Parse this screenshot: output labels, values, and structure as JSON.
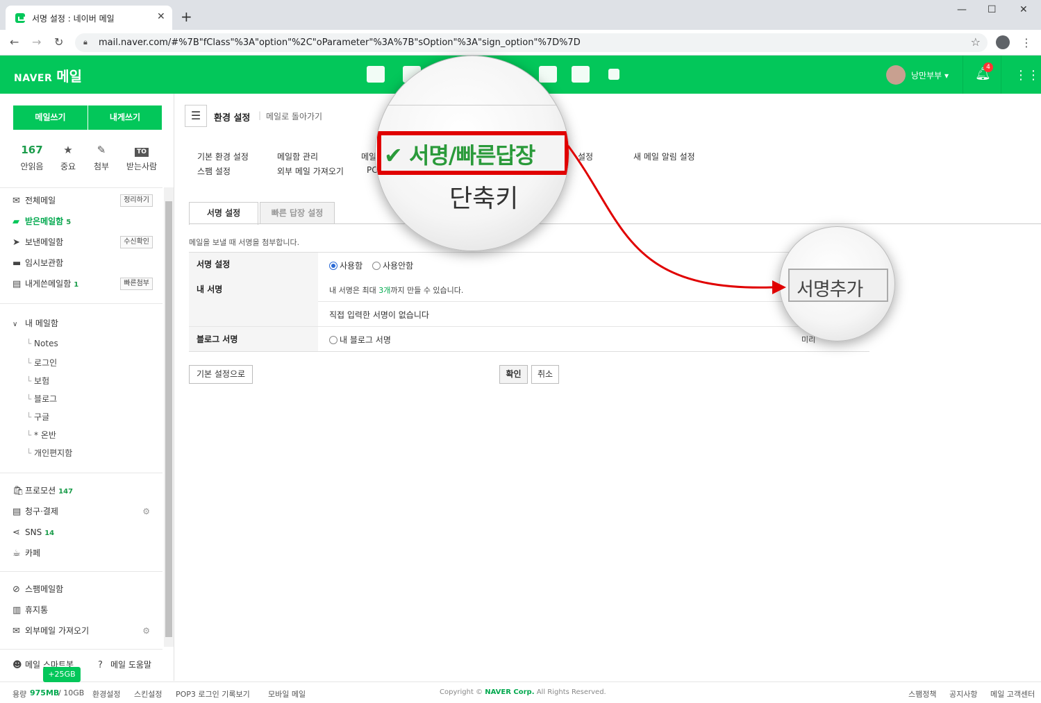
{
  "browser": {
    "tab_title": "서명 설정 : 네이버 메일",
    "tab_close": "✕",
    "new_tab": "+",
    "url": "mail.naver.com/#%7B\"fClass\"%3A\"option\"%2C\"oParameter\"%3A%7B\"sOption\"%3A\"sign_option\"%7D%7D"
  },
  "header": {
    "logo_naver": "NAVER",
    "logo_mail": "메일",
    "user_name": "낭만부부 ▾",
    "notification_count": "4",
    "accent_color": "#03c75a"
  },
  "sidebar": {
    "write_button": "메일쓰기",
    "self_write_button": "내게쓰기",
    "stats": [
      {
        "value": "167",
        "label": "안읽음"
      },
      {
        "icon": "star-icon",
        "label": "중요"
      },
      {
        "icon": "clip-icon",
        "label": "첨부"
      },
      {
        "icon": "to-icon",
        "value": "TO",
        "label": "받는사람"
      }
    ],
    "mailboxes": [
      {
        "label": "전체메일",
        "side_button": "정리하기"
      },
      {
        "label": "받은메일함",
        "count": "5"
      },
      {
        "label": "보낸메일함",
        "side_button": "수신확인"
      },
      {
        "label": "임시보관함"
      },
      {
        "label": "내게쓴메일함",
        "count": "1",
        "side_button": "빠른첨부"
      }
    ],
    "my_folder_title": "내 메일함",
    "my_folders": [
      "Notes",
      "로그인",
      "보험",
      "블로그",
      "구글",
      "* 온반",
      "개인편지함"
    ],
    "extras": [
      {
        "label": "프로모션",
        "count": "147"
      },
      {
        "label": "청구·결제"
      },
      {
        "label": "SNS",
        "count": "14"
      },
      {
        "label": "카페"
      }
    ],
    "bottom": [
      {
        "label": "스팸메일함"
      },
      {
        "label": "휴지통"
      },
      {
        "label": "외부메일 가져오기"
      }
    ],
    "smart_bot": "메일 스마트봇",
    "help": "메일 도움말"
  },
  "footer": {
    "storage_label": "용량",
    "storage_used": "975MB",
    "storage_total": "/ 10GB",
    "bonus_badge": "+25GB",
    "links_left": [
      "환경설정",
      "스킨설정",
      "POP3 로그인 기록보기",
      "모바일 메일"
    ],
    "copyright_prefix": "Copyright ©",
    "copyright_corp": "NAVER Corp.",
    "copyright_suffix": "All Rights Reserved.",
    "links_right": [
      "스팸정책",
      "공지사항",
      "메일 고객센터"
    ]
  },
  "main": {
    "title": "환경 설정",
    "back_link": "메일로 돌아가기",
    "settings_links_row1": [
      "기본 환경 설정",
      "메일함 관리",
      "메일",
      "설정",
      "새 메일 알림 설정"
    ],
    "settings_links_row2": [
      "스팸 설정",
      "외부 메일 가져오기",
      "PC"
    ],
    "tabs": [
      "서명 설정",
      "빠른 답장 설정"
    ],
    "description": "메일을 보낼 때 서명을 첨부합니다.",
    "sign_setting_label": "서명 설정",
    "use_option": "사용함",
    "nouse_option": "사용안함",
    "my_sign_label": "내 서명",
    "sign_limit_prefix": "내 서명은 최대 ",
    "sign_limit_count": "3개",
    "sign_limit_suffix": "까지 만들 수 있습니다.",
    "no_sign_text": "직접 입력한 서명이 없습니다",
    "blog_sign_label": "블로그 서명",
    "blog_sign_option": "내 블로그 서명",
    "preview_fragment": "미리",
    "reset_button": "기본 설정으로",
    "confirm_button": "확인",
    "cancel_button": "취소"
  },
  "annotation": {
    "magnifier1_title": "✔ 서명/빠른답장",
    "magnifier1_sub": "단축키",
    "magnifier2_button": "서명추가",
    "highlight_color": "#e00000"
  }
}
